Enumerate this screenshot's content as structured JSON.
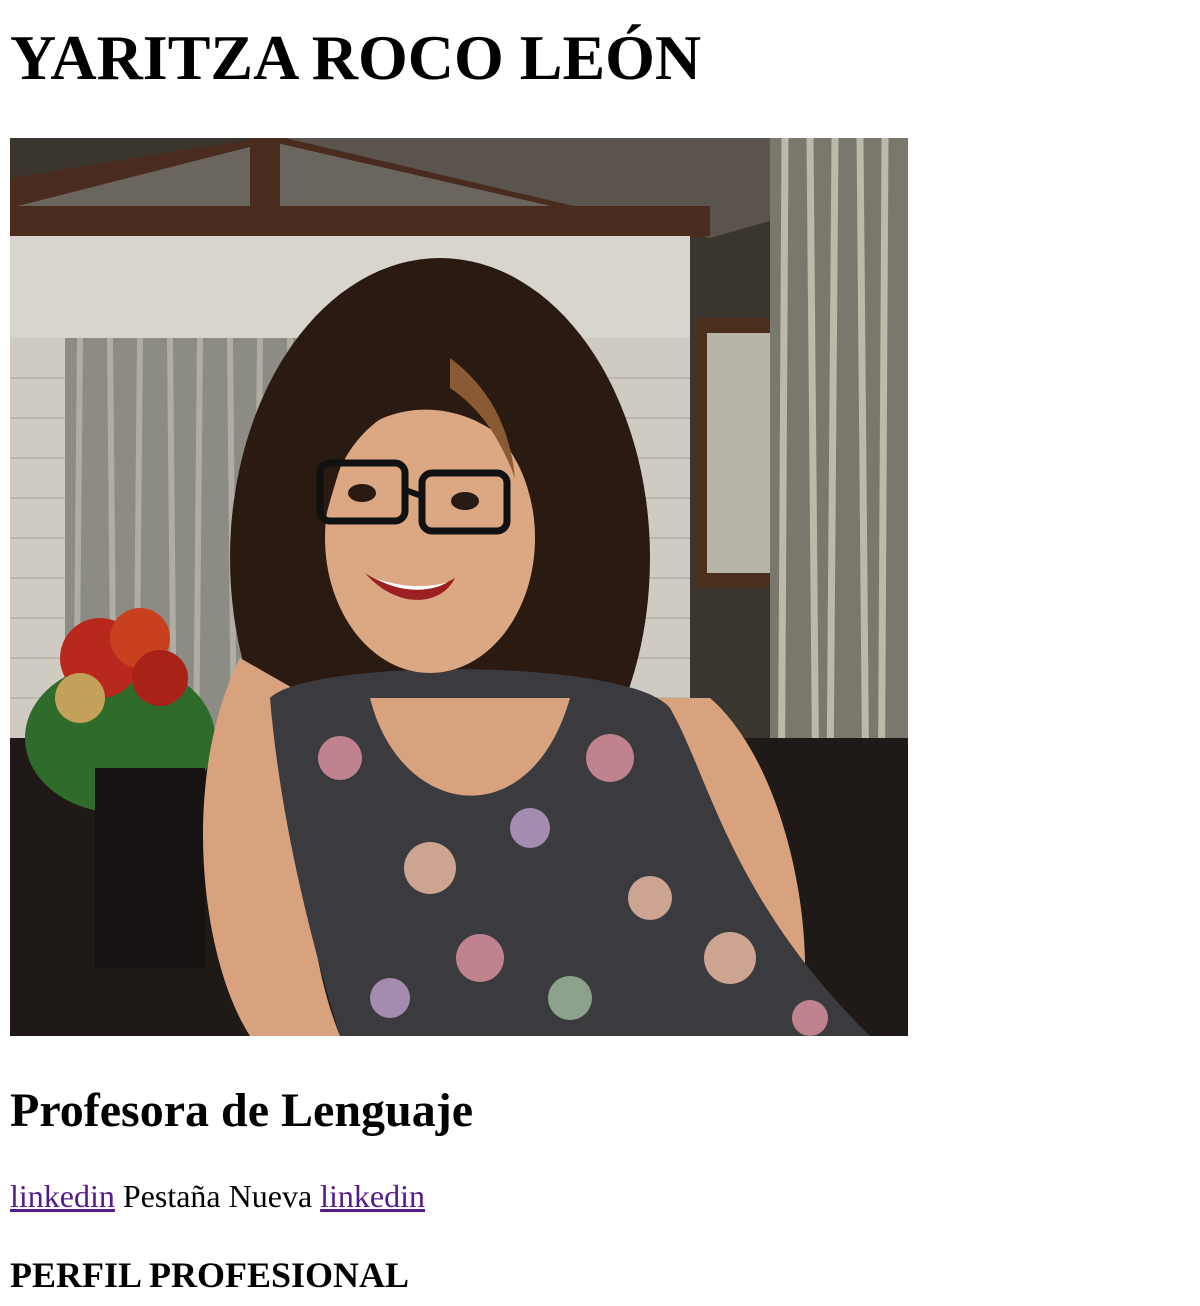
{
  "profile": {
    "name": "YARITZA ROCO LEÓN",
    "role": "Profesora de Lenguaje"
  },
  "links": {
    "first_label": "linkedin",
    "middle_text": "Pestaña Nueva",
    "second_label": "linkedin",
    "visited_color": "#551a8b"
  },
  "sections": {
    "profile_title": "PERFIL PROFESIONAL"
  }
}
